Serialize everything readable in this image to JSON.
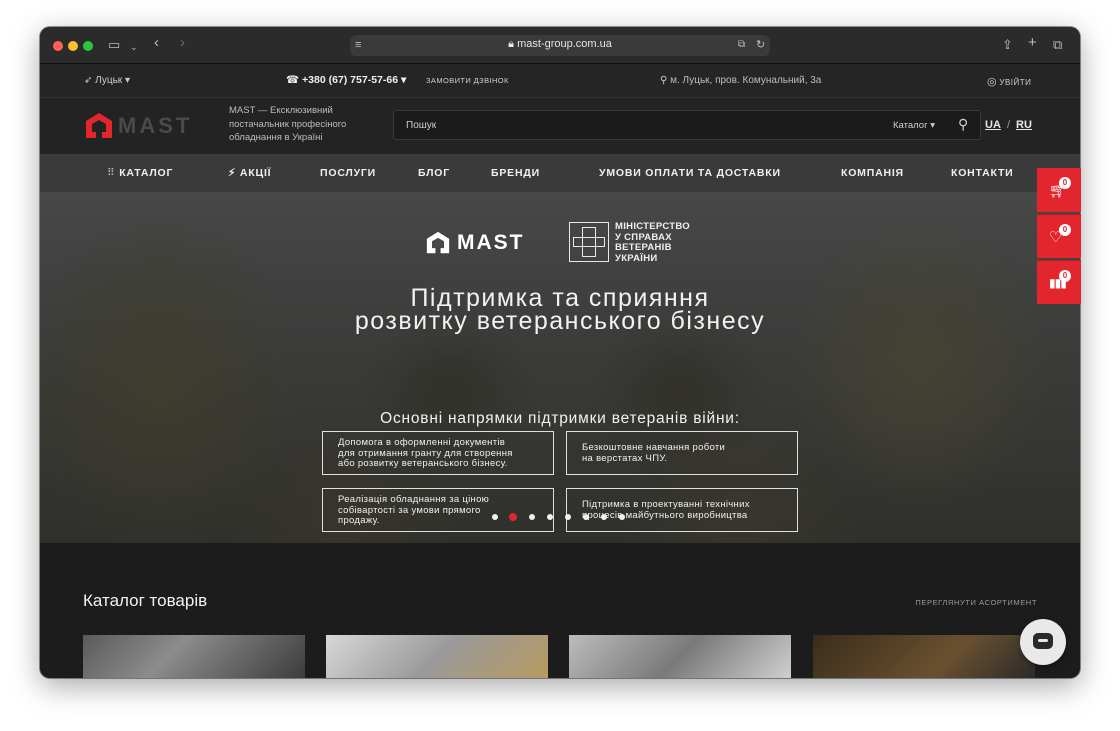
{
  "browser": {
    "url": "mast-group.com.ua"
  },
  "topbar": {
    "city": "Луцьк",
    "phone": "+380 (67) 757-57-66",
    "callback": "ЗАМОВИТИ ДЗВІНОК",
    "address": "м. Луцьк, пров. Комунальний, 3а",
    "login": "УВІЙТИ"
  },
  "header": {
    "logo_text": "MAST",
    "tagline": "MAST — Ексклюзивний постачальник професіного обладнання в Україні",
    "search_placeholder": "Пошук",
    "catalog_select": "Каталог",
    "lang_ua": "UA",
    "lang_sep": "/",
    "lang_ru": "RU"
  },
  "nav": {
    "catalog": "КАТАЛОГ",
    "sales": "АКЦІЇ",
    "services": "ПОСЛУГИ",
    "blog": "БЛОГ",
    "brands": "БРЕНДИ",
    "payment": "УМОВИ ОПЛАТИ ТА ДОСТАВКИ",
    "company": "КОМПАНІЯ",
    "contacts": "КОНТАКТИ"
  },
  "hero": {
    "logo_text": "MAST",
    "ministry": [
      "МІНІСТЕРСТВО",
      "У СПРАВАХ",
      "ВЕТЕРАНІВ",
      "УКРАЇНИ"
    ],
    "title_line1": "Підтримка та сприяння",
    "title_line2": "розвитку ветеранського бізнесу",
    "subtitle": "Основні напрямки підтримки ветеранів війни:",
    "boxes": [
      [
        "Допомога в оформленні документів",
        "для отримання гранту для створення",
        "або розвитку ветеранського бізнесу."
      ],
      [
        "Безкоштовне навчання роботи",
        "на верстатах ЧПУ."
      ],
      [
        "Реалізація обладнання за ціною",
        "собівартості за умови прямого",
        "продажу."
      ],
      [
        "Підтримка в проектуванні технічних",
        "процесів майбутнього виробництва"
      ]
    ],
    "slider_active": 2
  },
  "catalog_section": {
    "title": "Каталог товарів",
    "link": "ПЕРЕГЛЯНУТИ АСОРТИМЕНТ"
  },
  "side_counts": {
    "cart": "0",
    "favorites": "0",
    "compare": "0"
  },
  "colors": {
    "accent": "#e3262e",
    "dark": "#1c1c1c"
  }
}
